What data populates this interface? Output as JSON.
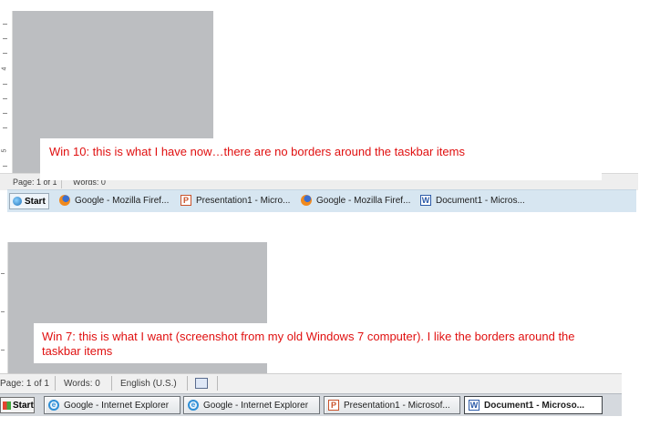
{
  "win10": {
    "note": "Win 10: this is what I have now…there are no borders around the taskbar items",
    "status": {
      "page": "Page: 1 of 1",
      "words": "Words: 0"
    },
    "ruler": {
      "nums": [
        "4",
        "5"
      ]
    },
    "start_label": "Start",
    "taskbar_items": [
      {
        "icon": "firefox-icon",
        "label": "Google - Mozilla Firef..."
      },
      {
        "icon": "powerpoint-icon",
        "label": "Presentation1 - Micro..."
      },
      {
        "icon": "firefox-icon",
        "label": "Google - Mozilla Firef..."
      },
      {
        "icon": "word-icon",
        "label": "Document1 - Micros..."
      }
    ]
  },
  "win7": {
    "note": "Win 7: this is what I want (screenshot from my old Windows 7 computer). I like the borders around the taskbar items",
    "status": {
      "page": "Page: 1 of 1",
      "words": "Words: 0",
      "language": "English (U.S.)"
    },
    "start_label": "Start",
    "taskbar_items": [
      {
        "icon": "internet-explorer-icon",
        "label": "Google - Internet Explorer"
      },
      {
        "icon": "internet-explorer-icon",
        "label": "Google - Internet Explorer"
      },
      {
        "icon": "powerpoint-icon",
        "label": "Presentation1 - Microsof..."
      },
      {
        "icon": "word-icon",
        "label": "Document1 - Microso...",
        "active": true
      }
    ]
  },
  "colors": {
    "note_text": "#e01010",
    "win10_taskbar": "#d7e6f1",
    "win7_taskbar": "#d5d9de"
  }
}
